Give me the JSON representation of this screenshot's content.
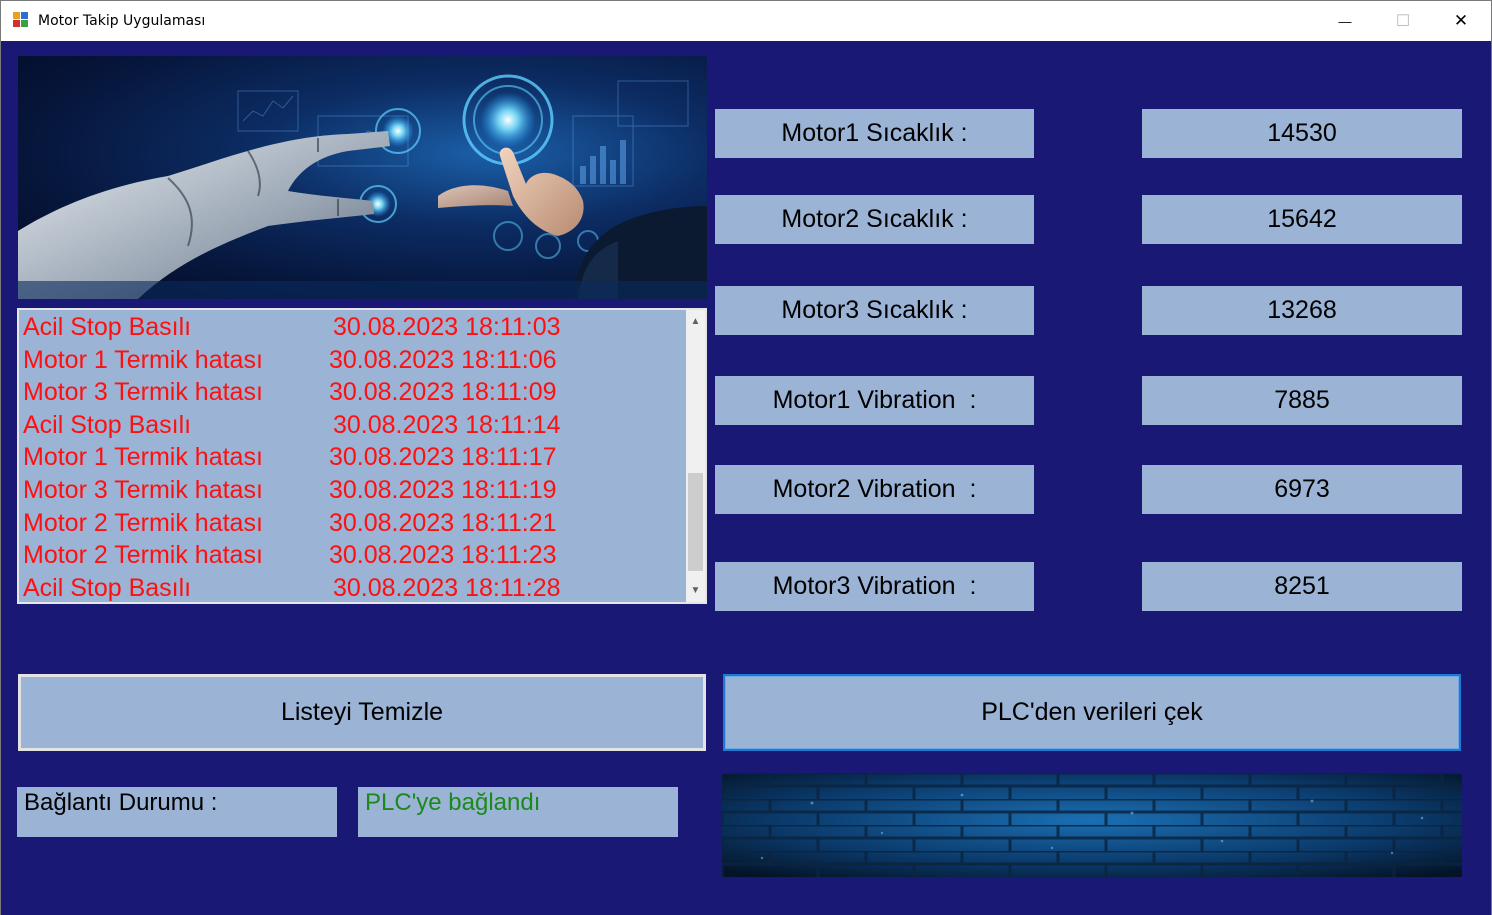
{
  "window": {
    "title": "Motor Takip Uygulaması",
    "minimize_glyph": "—",
    "maximize_glyph": "☐",
    "close_glyph": "✕"
  },
  "alarm_list": {
    "items": [
      {
        "message": "Acil Stop Basılı",
        "timestamp": "30.08.2023 18:11:03"
      },
      {
        "message": "Motor 1 Termik hatası",
        "timestamp": "30.08.2023 18:11:06"
      },
      {
        "message": "Motor 3 Termik hatası",
        "timestamp": "30.08.2023 18:11:09"
      },
      {
        "message": "Acil Stop Basılı",
        "timestamp": "30.08.2023 18:11:14"
      },
      {
        "message": "Motor 1 Termik hatası",
        "timestamp": "30.08.2023 18:11:17"
      },
      {
        "message": "Motor 3 Termik hatası",
        "timestamp": "30.08.2023 18:11:19"
      },
      {
        "message": "Motor 2 Termik hatası",
        "timestamp": "30.08.2023 18:11:21"
      },
      {
        "message": "Motor 2 Termik hatası",
        "timestamp": "30.08.2023 18:11:23"
      },
      {
        "message": "Acil Stop Basılı",
        "timestamp": "30.08.2023 18:11:28"
      }
    ],
    "text_color": "#ff1010"
  },
  "readings": {
    "motor1_temp_label": "Motor1 Sıcaklık :",
    "motor1_temp_value": "14530",
    "motor2_temp_label": "Motor2 Sıcaklık :",
    "motor2_temp_value": "15642",
    "motor3_temp_label": "Motor3 Sıcaklık :",
    "motor3_temp_value": "13268",
    "motor1_vib_label": "Motor1 Vibration  :",
    "motor1_vib_value": "7885",
    "motor2_vib_label": "Motor2 Vibration  :",
    "motor2_vib_value": "6973",
    "motor3_vib_label": "Motor3 Vibration  :",
    "motor3_vib_value": "8251"
  },
  "buttons": {
    "clear_list": "Listeyi Temizle",
    "fetch_plc": "PLC'den verileri çek"
  },
  "status": {
    "label": "Bağlantı Durumu :",
    "value": "PLC'ye bağlandı",
    "value_color": "#1a8a1a"
  },
  "colors": {
    "background": "#1a1875",
    "panel": "#9bb3d5"
  },
  "images": {
    "hero": "robot-hand-touch-image",
    "footer": "blue-brick-wall-image"
  }
}
